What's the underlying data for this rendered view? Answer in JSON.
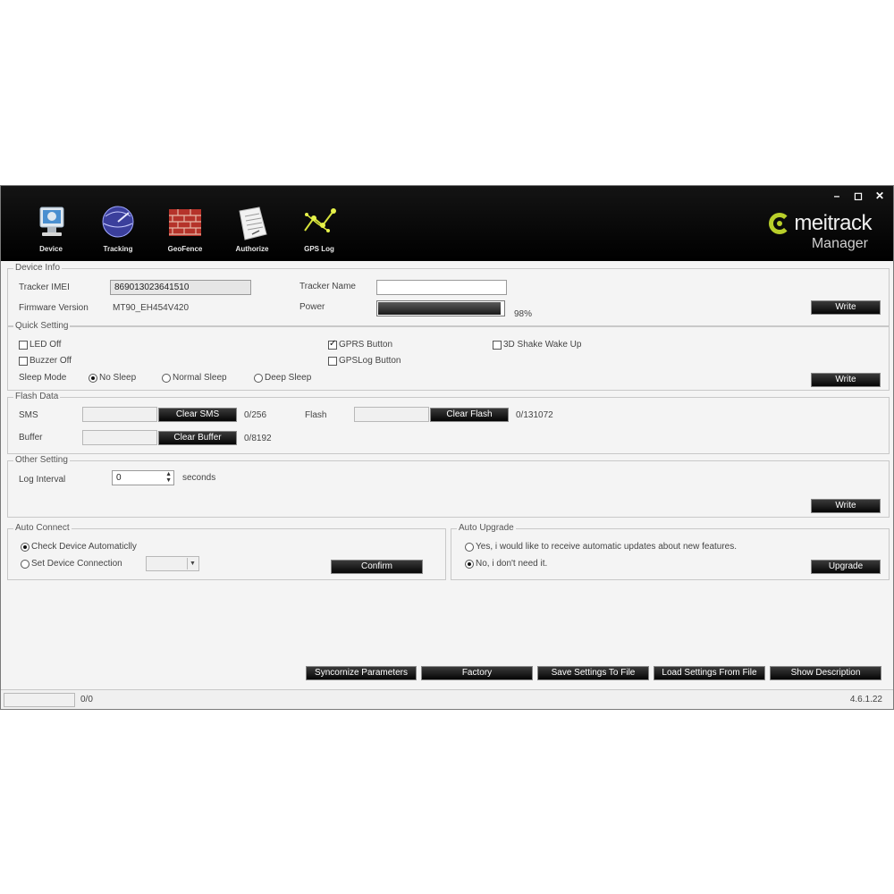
{
  "window": {
    "controls": {
      "minimize": "–",
      "restore": "◻",
      "close": "✕"
    }
  },
  "toolbar": {
    "items": [
      {
        "label": "Device",
        "icon": "computer-icon"
      },
      {
        "label": "Tracking",
        "icon": "globe-icon"
      },
      {
        "label": "GeoFence",
        "icon": "firewall-icon"
      },
      {
        "label": "Authorize",
        "icon": "document-icon"
      },
      {
        "label": "GPS Log",
        "icon": "route-icon"
      }
    ]
  },
  "brand": {
    "name": "meitrack",
    "sub": "Manager",
    "color": "#b9cf2a"
  },
  "device_info": {
    "title": "Device Info",
    "imei_label": "Tracker IMEI",
    "imei_value": "869013023641510",
    "firmware_label": "Firmware Version",
    "firmware_value": "MT90_EH454V420",
    "tracker_name_label": "Tracker Name",
    "tracker_name_value": "",
    "power_label": "Power",
    "power_percent_text": "98%",
    "power_fraction": 0.98,
    "write_label": "Write"
  },
  "quick_setting": {
    "title": "Quick Setting",
    "led_off": {
      "label": "LED Off",
      "checked": false
    },
    "buzzer_off": {
      "label": "Buzzer Off",
      "checked": false
    },
    "gprs_button": {
      "label": "GPRS Button",
      "checked": true
    },
    "gpslog_button": {
      "label": "GPSLog Button",
      "checked": false
    },
    "shake_wake": {
      "label": "3D Shake Wake Up",
      "checked": false
    },
    "sleep_mode_label": "Sleep Mode",
    "sleep_options": [
      {
        "label": "No Sleep",
        "checked": true
      },
      {
        "label": "Normal Sleep",
        "checked": false
      },
      {
        "label": "Deep Sleep",
        "checked": false
      }
    ],
    "write_label": "Write"
  },
  "flash_data": {
    "title": "Flash Data",
    "sms_label": "SMS",
    "clear_sms_label": "Clear SMS",
    "sms_count": "0/256",
    "buffer_label": "Buffer",
    "clear_buffer_label": "Clear Buffer",
    "buffer_count": "0/8192",
    "flash_label": "Flash",
    "clear_flash_label": "Clear Flash",
    "flash_count": "0/131072"
  },
  "other_setting": {
    "title": "Other Setting",
    "log_interval_label": "Log Interval",
    "log_interval_value": "0",
    "seconds_label": "seconds",
    "write_label": "Write"
  },
  "auto_connect": {
    "title": "Auto Connect",
    "check_auto": {
      "label": "Check Device Automaticlly",
      "checked": true
    },
    "set_conn": {
      "label": "Set Device Connection",
      "checked": false
    },
    "confirm_label": "Confirm"
  },
  "auto_upgrade": {
    "title": "Auto Upgrade",
    "yes": {
      "label": "Yes, i would like to receive automatic updates about new features.",
      "checked": false
    },
    "no": {
      "label": "No, i don't need it.",
      "checked": true
    },
    "upgrade_label": "Upgrade"
  },
  "bottom_buttons": {
    "sync": "Syncornize Parameters",
    "factory": "Factory",
    "save": "Save Settings To File",
    "load": "Load Settings From File",
    "show_desc": "Show Description"
  },
  "statusbar": {
    "progress_text": "0/0",
    "version": "4.6.1.22"
  }
}
